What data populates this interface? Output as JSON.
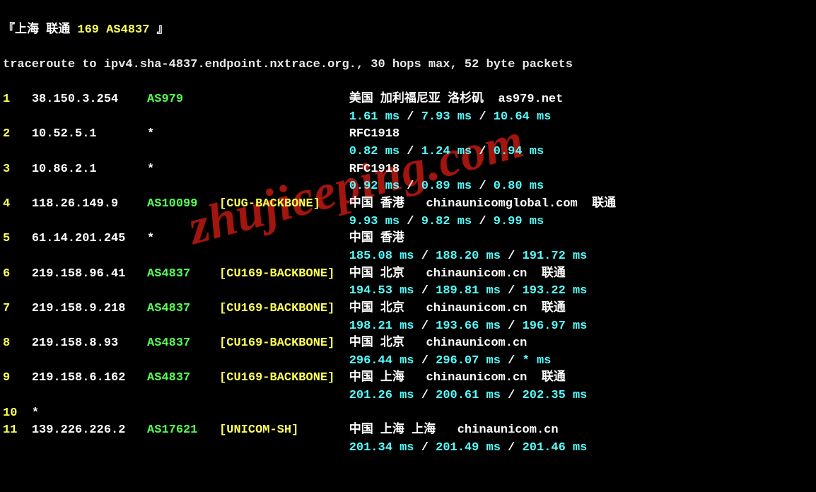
{
  "header": {
    "bracket_open": "『",
    "title_part1": "上海 联通 ",
    "title_part2": "169 AS4837 ",
    "bracket_close": "』"
  },
  "intro": "traceroute to ipv4.sha-4837.endpoint.nxtrace.org., 30 hops max, 52 byte packets",
  "hops": [
    {
      "num": "1",
      "ip": "38.150.3.254",
      "asn": "AS979",
      "backbone": "",
      "loc": "美国 加利福尼亚 洛杉矶  as979.net",
      "t1": "1.61 ms",
      "t2": "7.93 ms",
      "t3": "10.64 ms"
    },
    {
      "num": "2",
      "ip": "10.52.5.1",
      "asn": "*",
      "backbone": "",
      "loc": "RFC1918",
      "t1": "0.82 ms",
      "t2": "1.24 ms",
      "t3": "0.94 ms"
    },
    {
      "num": "3",
      "ip": "10.86.2.1",
      "asn": "*",
      "backbone": "",
      "loc": "RFC1918",
      "t1": "0.92 ms",
      "t2": "0.89 ms",
      "t3": "0.80 ms"
    },
    {
      "num": "4",
      "ip": "118.26.149.9",
      "asn": "AS10099",
      "backbone": "[CUG-BACKBONE]",
      "loc": "中国 香港   chinaunicomglobal.com  联通",
      "t1": "9.93 ms",
      "t2": "9.82 ms",
      "t3": "9.99 ms"
    },
    {
      "num": "5",
      "ip": "61.14.201.245",
      "asn": "*",
      "backbone": "",
      "loc": "中国 香港",
      "t1": "185.08 ms",
      "t2": "188.20 ms",
      "t3": "191.72 ms"
    },
    {
      "num": "6",
      "ip": "219.158.96.41",
      "asn": "AS4837",
      "backbone": "[CU169-BACKBONE]",
      "loc": "中国 北京   chinaunicom.cn  联通",
      "t1": "194.53 ms",
      "t2": "189.81 ms",
      "t3": "193.22 ms"
    },
    {
      "num": "7",
      "ip": "219.158.9.218",
      "asn": "AS4837",
      "backbone": "[CU169-BACKBONE]",
      "loc": "中国 北京   chinaunicom.cn  联通",
      "t1": "198.21 ms",
      "t2": "193.66 ms",
      "t3": "196.97 ms"
    },
    {
      "num": "8",
      "ip": "219.158.8.93",
      "asn": "AS4837",
      "backbone": "[CU169-BACKBONE]",
      "loc": "中国 北京   chinaunicom.cn",
      "t1": "296.44 ms",
      "t2": "296.07 ms",
      "t3": "* ms"
    },
    {
      "num": "9",
      "ip": "219.158.6.162",
      "asn": "AS4837",
      "backbone": "[CU169-BACKBONE]",
      "loc": "中国 上海   chinaunicom.cn  联通",
      "t1": "201.26 ms",
      "t2": "200.61 ms",
      "t3": "202.35 ms"
    },
    {
      "num": "10",
      "ip": "*",
      "asn": "",
      "backbone": "",
      "loc": "",
      "t1": "",
      "t2": "",
      "t3": ""
    },
    {
      "num": "11",
      "ip": "139.226.226.2",
      "asn": "AS17621",
      "backbone": "[UNICOM-SH]",
      "loc": "中国 上海 上海   chinaunicom.cn",
      "t1": "201.34 ms",
      "t2": "201.49 ms",
      "t3": "201.46 ms"
    }
  ],
  "sep": " / ",
  "watermark": "zhujiceping.com"
}
